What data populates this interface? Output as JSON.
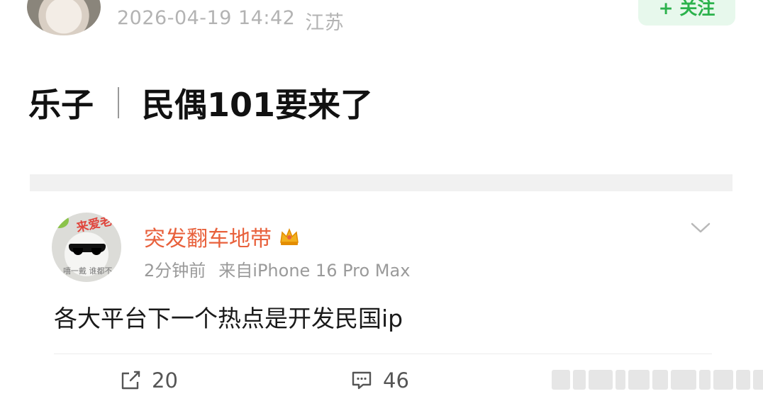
{
  "post": {
    "timestamp": "2026-04-19 14:42",
    "location": "江苏",
    "follow_label": "+ 关注",
    "title_left": "乐子",
    "title_right": "民偶101要来了"
  },
  "comment": {
    "username": "突发翻车地带",
    "avatar_sticker_text": "来爱老",
    "avatar_caption": "嘻一戴 谁都不",
    "time": "2分钟前",
    "source": "来自iPhone 16 Pro Max",
    "text": "各大平台下一个热点是开发民国ip"
  },
  "actions": {
    "repost_count": "20",
    "comment_count": "46"
  },
  "icons": {
    "crown": "crown-icon",
    "chevron": "chevron-down-icon",
    "repost": "share-icon",
    "comment": "comment-icon"
  },
  "colors": {
    "username": "#e8613c",
    "follow_bg": "#e7f8ec",
    "follow_fg": "#2bb24c",
    "meta": "#9a9a9a"
  }
}
